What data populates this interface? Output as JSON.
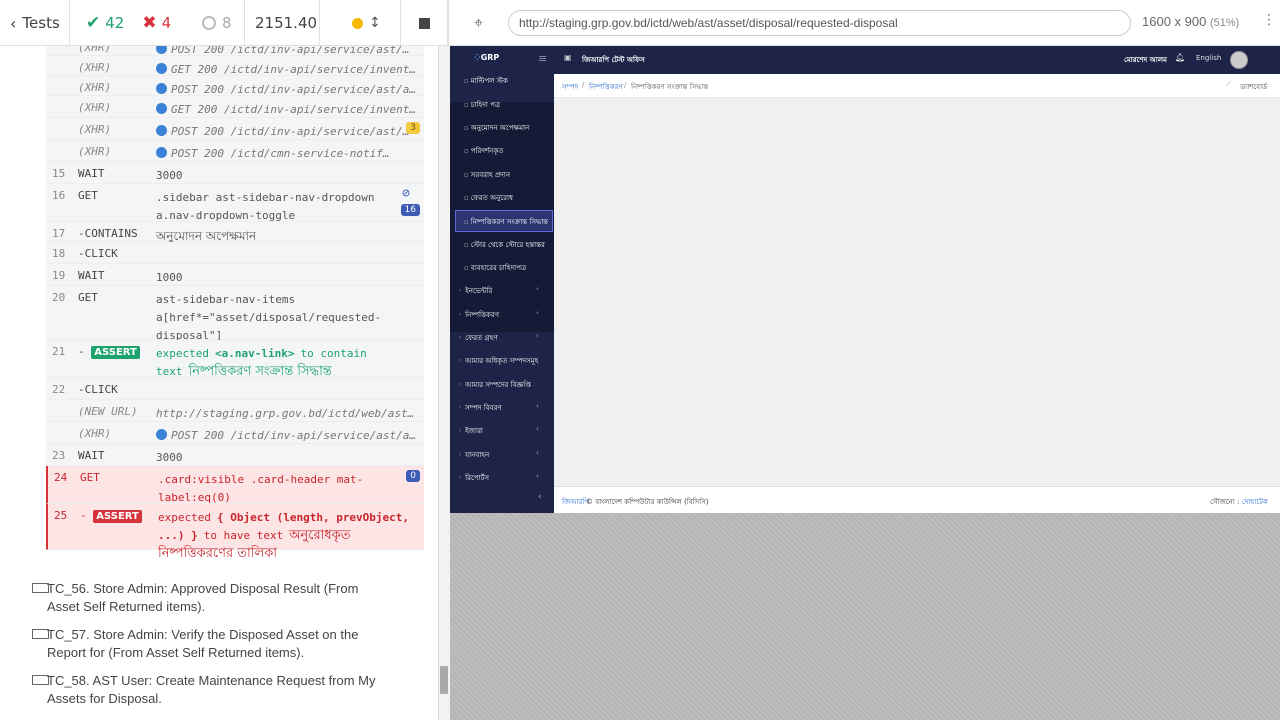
{
  "runner": {
    "back_label": "Tests",
    "passed": "42",
    "failed": "4",
    "pending": "8",
    "duration": "2151.40",
    "url": "http://staging.grp.gov.bd/ictd/web/ast/asset/disposal/requested-disposal",
    "viewport": "1600 x 900",
    "scale": "(51%)"
  },
  "commands": [
    {
      "num": "",
      "cmd": "(XHR)",
      "msg": "POST 200 /ictd/inv-api/service/ast/…",
      "type": "xhr"
    },
    {
      "num": "",
      "cmd": "(XHR)",
      "msg": "GET 200 /ictd/inv-api/service/invent…",
      "type": "xhr"
    },
    {
      "num": "",
      "cmd": "(XHR)",
      "msg": "POST 200 /ictd/inv-api/service/ast/ast-com-…",
      "type": "xhr"
    },
    {
      "num": "",
      "cmd": "(XHR)",
      "msg": "GET 200 /ictd/inv-api/service/invent…",
      "type": "xhr"
    },
    {
      "num": "",
      "cmd": "(XHR)",
      "msg": "POST 200 /ictd/inv-api/service/ast/…",
      "type": "xhr",
      "badge": "3"
    },
    {
      "num": "",
      "cmd": "(XHR)",
      "msg": "POST 200 /ictd/cmn-service-notif…",
      "type": "xhr"
    },
    {
      "num": "15",
      "cmd": "WAIT",
      "msg": "3000"
    },
    {
      "num": "16",
      "cmd": "GET",
      "msg": ".sidebar ast-sidebar-nav-dropdown a.nav-dropdown-toggle",
      "badge": "16"
    },
    {
      "num": "17",
      "cmd": "-CONTAINS",
      "msg": "অনুমোদন অপেক্ষমান"
    },
    {
      "num": "18",
      "cmd": "-CLICK",
      "msg": ""
    },
    {
      "num": "19",
      "cmd": "WAIT",
      "msg": "1000"
    },
    {
      "num": "20",
      "cmd": "GET",
      "msg": "ast-sidebar-nav-items a[href*=\"asset/disposal/requested-disposal\"]"
    },
    {
      "num": "21",
      "cmd": "ASSERT",
      "msg_pre": "expected",
      "msg_code": "<a.nav-link>",
      "msg_mid": "to contain text",
      "msg_bn": "নিষ্পত্তিকরণ সংক্রান্ত সিদ্ধান্ত"
    },
    {
      "num": "22",
      "cmd": "-CLICK",
      "msg": ""
    },
    {
      "num": "",
      "cmd": "(NEW URL)",
      "msg": "http://staging.grp.gov.bd/ictd/web/ast…",
      "type": "xhr"
    },
    {
      "num": "",
      "cmd": "(XHR)",
      "msg": "POST 200 /ictd/inv-api/service/ast/a…",
      "type": "xhr"
    },
    {
      "num": "23",
      "cmd": "WAIT",
      "msg": "3000"
    },
    {
      "num": "24",
      "cmd": "GET",
      "msg": ".card:visible .card-header mat-label:eq(0)",
      "badge": "0"
    },
    {
      "num": "25",
      "cmd": "ASSERT",
      "msg_pre": "expected",
      "msg_code": "{ Object (length, prevObject, ...) }",
      "msg_mid": "to have text",
      "msg_bn": "অনুরোধকৃত নিষ্পত্তিকরণের তালিকা"
    }
  ],
  "tests": [
    "TC_56. Store Admin: Approved Disposal Result (From Asset Self Returned items).",
    "TC_57. Store Admin: Verify the Disposed Asset on the Report for (From Asset Self Returned items).",
    "TC_58. AST User: Create Maintenance Request from My Assets for Disposal."
  ],
  "app": {
    "logo": "GRP",
    "office": "জিআরপি টেস্ট অফিস",
    "user": "মোরশেদ আলম",
    "lang": "English",
    "breadcrumb": [
      "সম্পদ",
      "নিষ্পত্তিকরণ",
      "নিষ্পত্তিকরণ সংক্রান্ত সিদ্ধান্ত"
    ],
    "dashboard": "ড্যাশবোর্ড",
    "sub_items": [
      "মাল্টিপল স্টক",
      "চাহিদা পত্র",
      "অনুমোদন অপেক্ষমান",
      "পরিদর্শনকৃত",
      "সরবরাহ প্রদান",
      "ফেরত অনুরোধ",
      "নিষ্পত্তিকরণ সংক্রান্ত সিদ্ধান্ত",
      "স্টোর থেকে স্টোরে হস্তান্তর",
      "ব্যবহারের চাহিদাপত্র"
    ],
    "menu_items": [
      "ইনভেন্টরি",
      "নিষ্পত্তিকরণ",
      "ফেরত গ্রহণ",
      "আমার অধিকৃত সম্পদসমূহ",
      "আমার সম্পদের বিজ্ঞপ্তি",
      "সম্পদ বিবরণ",
      "ইজারা",
      "যানবাহন",
      "রিপোর্টস"
    ],
    "footer_left_link": "জিআরপি",
    "footer_left": "© বাংলাদেশ কম্পিউটার কাউন্সিল (বিসিসি)",
    "footer_right_label": "সৌজন্যে :",
    "footer_right_link": "দোহাটেক"
  }
}
